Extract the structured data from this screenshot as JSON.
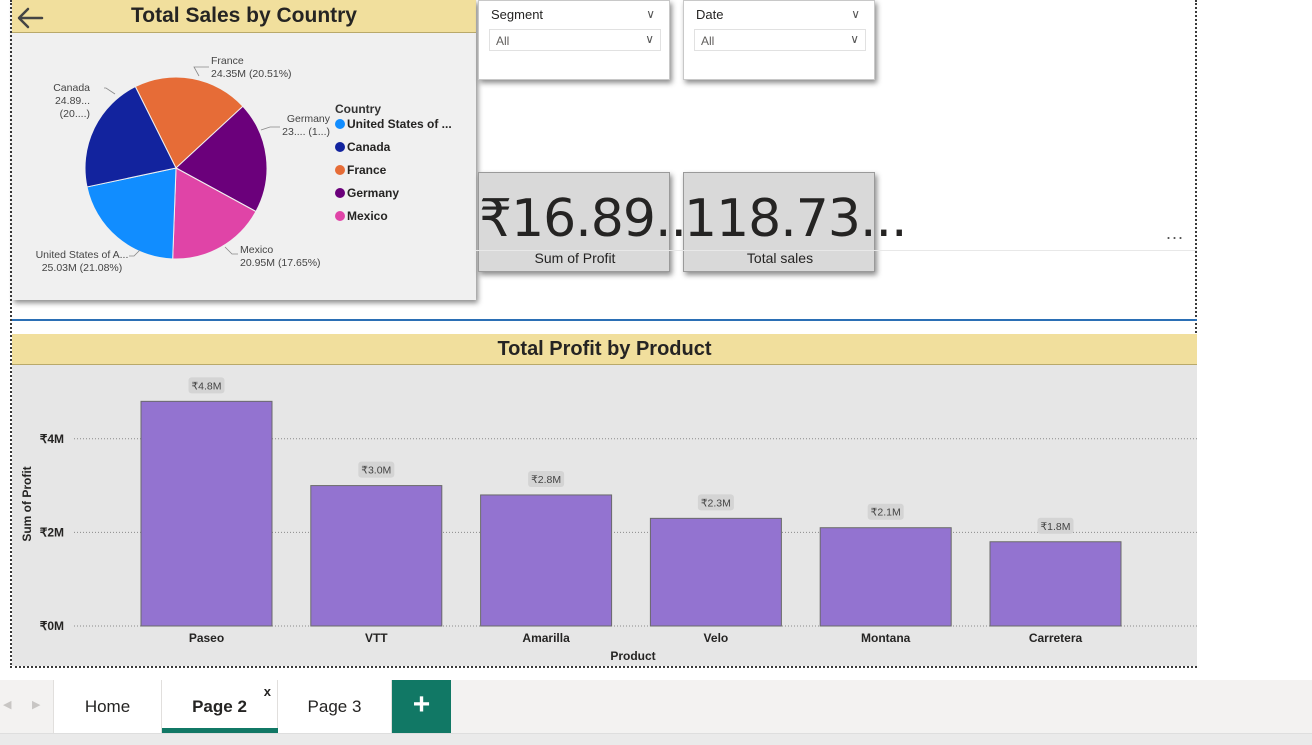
{
  "pie_card": {
    "title": "Total Sales by Country",
    "legend_title": "Country",
    "legend": [
      {
        "label": "United States of ...",
        "color": "#118dff"
      },
      {
        "label": "Canada",
        "color": "#12239e"
      },
      {
        "label": "France",
        "color": "#e66c37"
      },
      {
        "label": "Germany",
        "color": "#6b007b"
      },
      {
        "label": "Mexico",
        "color": "#e044a7"
      }
    ],
    "slice_labels": {
      "france_name": "France",
      "france_value": "24.35M (20.51%)",
      "canada_name": "Canada",
      "canada_value": "24.89... (20....)",
      "germany_name": "Germany",
      "germany_value": "23.... (1...)",
      "usa_name": "United States of A...",
      "usa_value": "25.03M (21.08%)",
      "mexico_name": "Mexico",
      "mexico_value": "20.95M (17.65%)"
    }
  },
  "slicers": {
    "segment": {
      "title": "Segment",
      "value": "All"
    },
    "date": {
      "title": "Date",
      "value": "All"
    }
  },
  "cards": {
    "profit": {
      "value": "₹16.89...",
      "label": "Sum of Profit"
    },
    "sales": {
      "value": "118.73...",
      "label": "Total sales"
    }
  },
  "more_options": "...",
  "bar_card": {
    "title": "Total Profit by Product"
  },
  "chart_data": {
    "type": "bar",
    "title": "Total Profit by Product",
    "xlabel": "Product",
    "ylabel": "Sum of Profit",
    "categories": [
      "Paseo",
      "VTT",
      "Amarilla",
      "Velo",
      "Montana",
      "Carretera"
    ],
    "values": [
      4.8,
      3.0,
      2.8,
      2.3,
      2.1,
      1.8
    ],
    "data_labels": [
      "₹4.8M",
      "₹3.0M",
      "₹2.8M",
      "₹2.3M",
      "₹2.1M",
      "₹1.8M"
    ],
    "yticks": [
      0,
      2,
      4
    ],
    "ytick_labels": [
      "₹0M",
      "₹2M",
      "₹4M"
    ],
    "ylim": [
      0,
      4.85
    ],
    "bar_color": "#9373d0",
    "grid": true
  },
  "pie_chart_data": {
    "type": "pie",
    "title": "Total Sales by Country",
    "slices": [
      {
        "label": "France",
        "value": 24.35,
        "color": "#e66c37"
      },
      {
        "label": "Germany",
        "value": 23.5,
        "color": "#6b007b"
      },
      {
        "label": "Mexico",
        "value": 20.95,
        "color": "#e044a7"
      },
      {
        "label": "United States of America",
        "value": 25.03,
        "color": "#118dff"
      },
      {
        "label": "Canada",
        "value": 24.89,
        "color": "#12239e"
      }
    ]
  },
  "tabs": [
    {
      "label": "Home"
    },
    {
      "label": "Page 2",
      "close": "x"
    },
    {
      "label": "Page 3"
    }
  ],
  "add_tab_label": "+",
  "colors": {
    "accent": "#117865",
    "title_band": "#f1df9d",
    "active_tab_underline": "#117865"
  }
}
